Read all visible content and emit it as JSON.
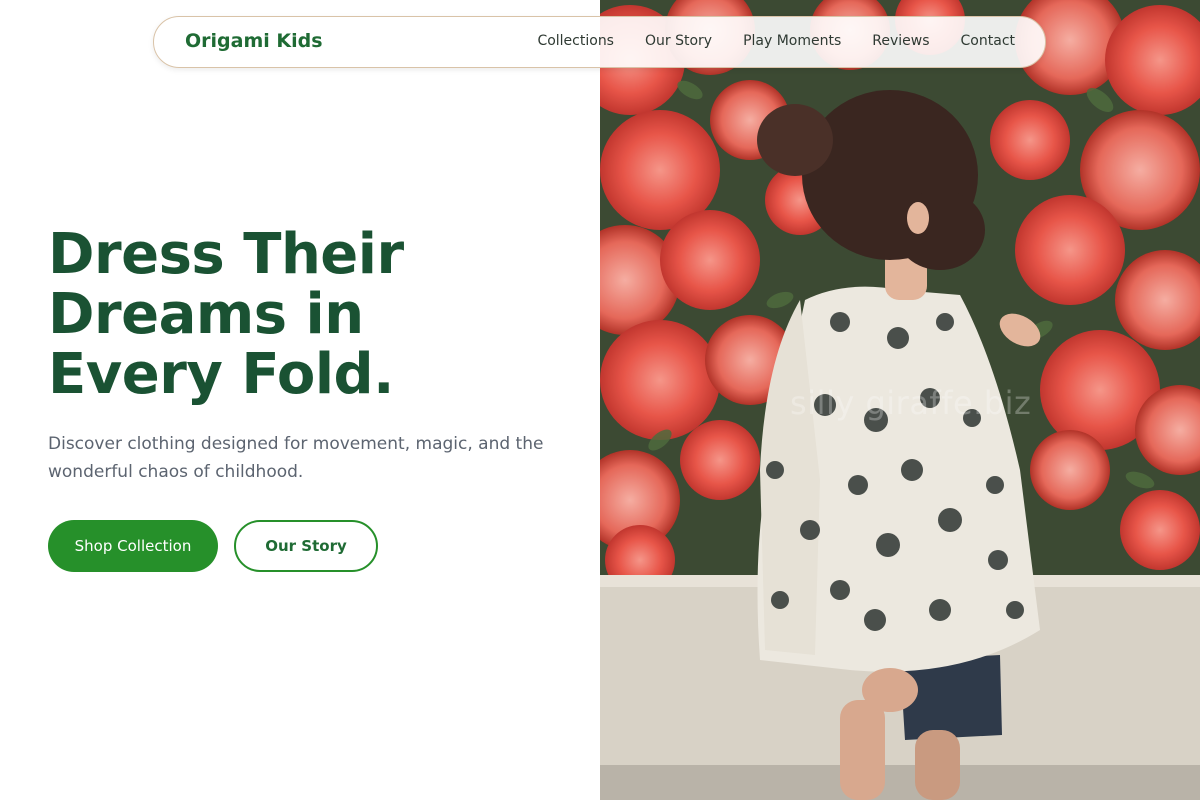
{
  "brand": {
    "name": "Origami Kids"
  },
  "nav": {
    "links": [
      "Collections",
      "Our Story",
      "Play Moments",
      "Reviews",
      "Contact"
    ]
  },
  "hero": {
    "headline_lines": [
      "Dress Their",
      "Dreams in",
      "Every Fold."
    ],
    "subtitle": "Discover clothing designed for movement, magic, and the wonderful chaos of childhood.",
    "primary_cta": "Shop Collection",
    "secondary_cta": "Our Story"
  },
  "photo": {
    "description_icon": "hero-photo",
    "watermark": "silly giraffe.biz"
  },
  "colors": {
    "brand_green": "#1f6b34",
    "headline_green": "#1a5233",
    "button_green": "#26902a",
    "nav_border": "#d9c3a8",
    "body_text": "#5c6470"
  }
}
